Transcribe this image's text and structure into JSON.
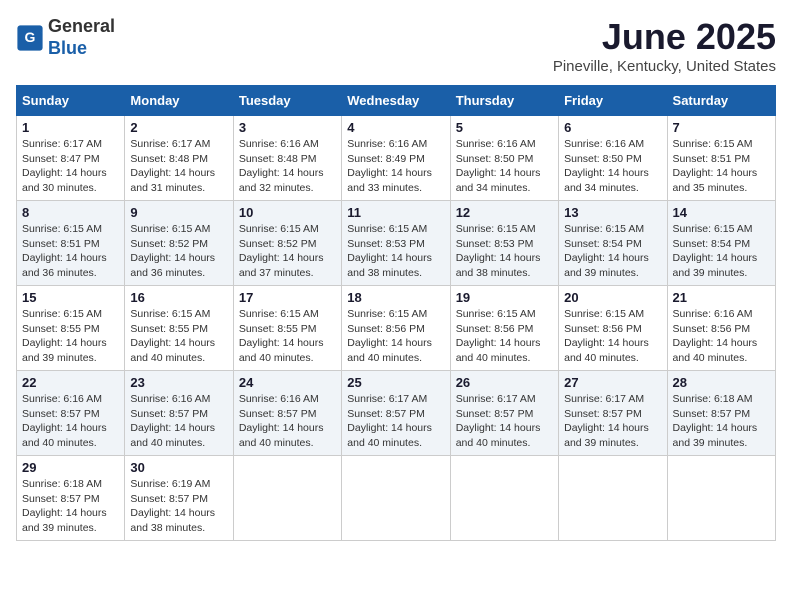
{
  "header": {
    "logo_line1": "General",
    "logo_line2": "Blue",
    "month": "June 2025",
    "location": "Pineville, Kentucky, United States"
  },
  "weekdays": [
    "Sunday",
    "Monday",
    "Tuesday",
    "Wednesday",
    "Thursday",
    "Friday",
    "Saturday"
  ],
  "weeks": [
    [
      {
        "day": "1",
        "sunrise": "Sunrise: 6:17 AM",
        "sunset": "Sunset: 8:47 PM",
        "daylight": "Daylight: 14 hours and 30 minutes."
      },
      {
        "day": "2",
        "sunrise": "Sunrise: 6:17 AM",
        "sunset": "Sunset: 8:48 PM",
        "daylight": "Daylight: 14 hours and 31 minutes."
      },
      {
        "day": "3",
        "sunrise": "Sunrise: 6:16 AM",
        "sunset": "Sunset: 8:48 PM",
        "daylight": "Daylight: 14 hours and 32 minutes."
      },
      {
        "day": "4",
        "sunrise": "Sunrise: 6:16 AM",
        "sunset": "Sunset: 8:49 PM",
        "daylight": "Daylight: 14 hours and 33 minutes."
      },
      {
        "day": "5",
        "sunrise": "Sunrise: 6:16 AM",
        "sunset": "Sunset: 8:50 PM",
        "daylight": "Daylight: 14 hours and 34 minutes."
      },
      {
        "day": "6",
        "sunrise": "Sunrise: 6:16 AM",
        "sunset": "Sunset: 8:50 PM",
        "daylight": "Daylight: 14 hours and 34 minutes."
      },
      {
        "day": "7",
        "sunrise": "Sunrise: 6:15 AM",
        "sunset": "Sunset: 8:51 PM",
        "daylight": "Daylight: 14 hours and 35 minutes."
      }
    ],
    [
      {
        "day": "8",
        "sunrise": "Sunrise: 6:15 AM",
        "sunset": "Sunset: 8:51 PM",
        "daylight": "Daylight: 14 hours and 36 minutes."
      },
      {
        "day": "9",
        "sunrise": "Sunrise: 6:15 AM",
        "sunset": "Sunset: 8:52 PM",
        "daylight": "Daylight: 14 hours and 36 minutes."
      },
      {
        "day": "10",
        "sunrise": "Sunrise: 6:15 AM",
        "sunset": "Sunset: 8:52 PM",
        "daylight": "Daylight: 14 hours and 37 minutes."
      },
      {
        "day": "11",
        "sunrise": "Sunrise: 6:15 AM",
        "sunset": "Sunset: 8:53 PM",
        "daylight": "Daylight: 14 hours and 38 minutes."
      },
      {
        "day": "12",
        "sunrise": "Sunrise: 6:15 AM",
        "sunset": "Sunset: 8:53 PM",
        "daylight": "Daylight: 14 hours and 38 minutes."
      },
      {
        "day": "13",
        "sunrise": "Sunrise: 6:15 AM",
        "sunset": "Sunset: 8:54 PM",
        "daylight": "Daylight: 14 hours and 39 minutes."
      },
      {
        "day": "14",
        "sunrise": "Sunrise: 6:15 AM",
        "sunset": "Sunset: 8:54 PM",
        "daylight": "Daylight: 14 hours and 39 minutes."
      }
    ],
    [
      {
        "day": "15",
        "sunrise": "Sunrise: 6:15 AM",
        "sunset": "Sunset: 8:55 PM",
        "daylight": "Daylight: 14 hours and 39 minutes."
      },
      {
        "day": "16",
        "sunrise": "Sunrise: 6:15 AM",
        "sunset": "Sunset: 8:55 PM",
        "daylight": "Daylight: 14 hours and 40 minutes."
      },
      {
        "day": "17",
        "sunrise": "Sunrise: 6:15 AM",
        "sunset": "Sunset: 8:55 PM",
        "daylight": "Daylight: 14 hours and 40 minutes."
      },
      {
        "day": "18",
        "sunrise": "Sunrise: 6:15 AM",
        "sunset": "Sunset: 8:56 PM",
        "daylight": "Daylight: 14 hours and 40 minutes."
      },
      {
        "day": "19",
        "sunrise": "Sunrise: 6:15 AM",
        "sunset": "Sunset: 8:56 PM",
        "daylight": "Daylight: 14 hours and 40 minutes."
      },
      {
        "day": "20",
        "sunrise": "Sunrise: 6:15 AM",
        "sunset": "Sunset: 8:56 PM",
        "daylight": "Daylight: 14 hours and 40 minutes."
      },
      {
        "day": "21",
        "sunrise": "Sunrise: 6:16 AM",
        "sunset": "Sunset: 8:56 PM",
        "daylight": "Daylight: 14 hours and 40 minutes."
      }
    ],
    [
      {
        "day": "22",
        "sunrise": "Sunrise: 6:16 AM",
        "sunset": "Sunset: 8:57 PM",
        "daylight": "Daylight: 14 hours and 40 minutes."
      },
      {
        "day": "23",
        "sunrise": "Sunrise: 6:16 AM",
        "sunset": "Sunset: 8:57 PM",
        "daylight": "Daylight: 14 hours and 40 minutes."
      },
      {
        "day": "24",
        "sunrise": "Sunrise: 6:16 AM",
        "sunset": "Sunset: 8:57 PM",
        "daylight": "Daylight: 14 hours and 40 minutes."
      },
      {
        "day": "25",
        "sunrise": "Sunrise: 6:17 AM",
        "sunset": "Sunset: 8:57 PM",
        "daylight": "Daylight: 14 hours and 40 minutes."
      },
      {
        "day": "26",
        "sunrise": "Sunrise: 6:17 AM",
        "sunset": "Sunset: 8:57 PM",
        "daylight": "Daylight: 14 hours and 40 minutes."
      },
      {
        "day": "27",
        "sunrise": "Sunrise: 6:17 AM",
        "sunset": "Sunset: 8:57 PM",
        "daylight": "Daylight: 14 hours and 39 minutes."
      },
      {
        "day": "28",
        "sunrise": "Sunrise: 6:18 AM",
        "sunset": "Sunset: 8:57 PM",
        "daylight": "Daylight: 14 hours and 39 minutes."
      }
    ],
    [
      {
        "day": "29",
        "sunrise": "Sunrise: 6:18 AM",
        "sunset": "Sunset: 8:57 PM",
        "daylight": "Daylight: 14 hours and 39 minutes."
      },
      {
        "day": "30",
        "sunrise": "Sunrise: 6:19 AM",
        "sunset": "Sunset: 8:57 PM",
        "daylight": "Daylight: 14 hours and 38 minutes."
      },
      null,
      null,
      null,
      null,
      null
    ]
  ]
}
